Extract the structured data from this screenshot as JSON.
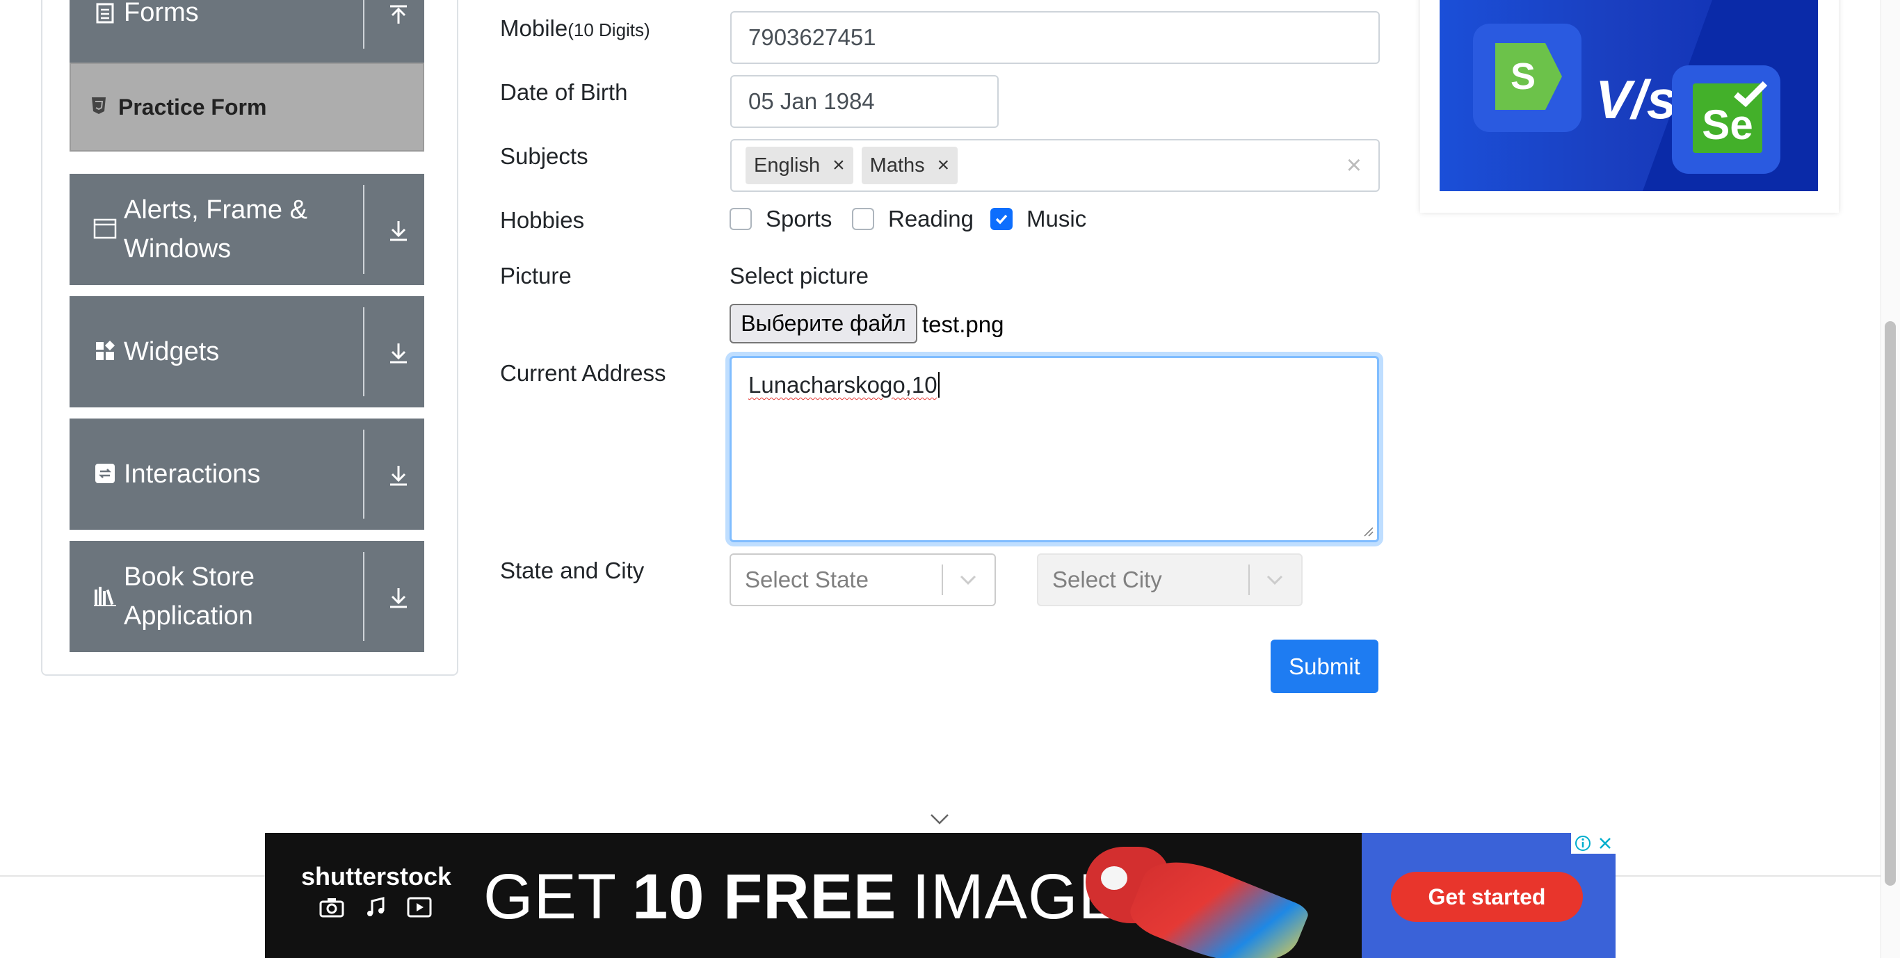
{
  "sidebar": {
    "forms_label": "Forms",
    "practice_label": "Practice Form",
    "items": [
      {
        "label": "Alerts, Frame & Windows",
        "icon": "window-icon"
      },
      {
        "label": "Widgets",
        "icon": "widgets-icon"
      },
      {
        "label": "Interactions",
        "icon": "interactions-icon"
      },
      {
        "label": "Book Store Application",
        "icon": "books-icon"
      }
    ]
  },
  "form": {
    "mobile": {
      "label": "Mobile",
      "hint": "(10 Digits)",
      "value": "7903627451"
    },
    "dob": {
      "label": "Date of Birth",
      "value": "05 Jan 1984"
    },
    "subjects": {
      "label": "Subjects",
      "tags": [
        "English",
        "Maths"
      ]
    },
    "hobbies": {
      "label": "Hobbies",
      "options": [
        {
          "label": "Sports",
          "checked": false
        },
        {
          "label": "Reading",
          "checked": false
        },
        {
          "label": "Music",
          "checked": true
        }
      ]
    },
    "picture": {
      "label": "Picture",
      "select_label": "Select picture",
      "button": "Выберите файл",
      "file_name": "test.png"
    },
    "address": {
      "label": "Current Address",
      "value": "Lunacharskogo,10"
    },
    "state_city": {
      "label": "State and City",
      "state_placeholder": "Select State",
      "city_placeholder": "Select City"
    },
    "submit": "Submit"
  },
  "ads": {
    "top_vs": "V/s",
    "bottom_brand": "shutterstock",
    "bottom_headline_1": "GET",
    "bottom_headline_2": "10 FREE",
    "bottom_headline_3": "IMAGES",
    "bottom_cta": "Get started"
  },
  "colors": {
    "primary": "#1e7cf2",
    "menu_bg": "#6c757d",
    "ad_cta": "#e8352c"
  }
}
